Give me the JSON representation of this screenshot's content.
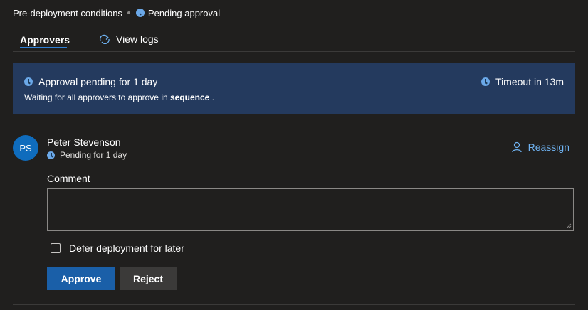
{
  "breadcrumb": {
    "section": "Pre-deployment conditions",
    "status": "Pending approval"
  },
  "tabs": {
    "approvers": "Approvers",
    "view_logs": "View logs"
  },
  "banner": {
    "title": "Approval pending for 1 day",
    "subtitle_prefix": "Waiting for all approvers to approve in",
    "subtitle_emphasis": "sequence",
    "subtitle_suffix": ".",
    "timeout": "Timeout in 13m"
  },
  "approver": {
    "initials": "PS",
    "name": "Peter Stevenson",
    "status": "Pending for 1 day",
    "reassign_label": "Reassign"
  },
  "comment": {
    "label": "Comment",
    "value": "",
    "placeholder": ""
  },
  "defer": {
    "label": "Defer deployment for later",
    "checked": false
  },
  "actions": {
    "approve": "Approve",
    "reject": "Reject"
  },
  "colors": {
    "background": "#201f1e",
    "banner": "#243a5e",
    "accent": "#2f7fd4",
    "primary_button": "#1a5fa8",
    "avatar": "#0f6cbd",
    "link": "#6fb3f2"
  },
  "icons": {
    "status": "clock-icon",
    "logs": "refresh-arrow-icon",
    "reassign": "person-icon"
  }
}
